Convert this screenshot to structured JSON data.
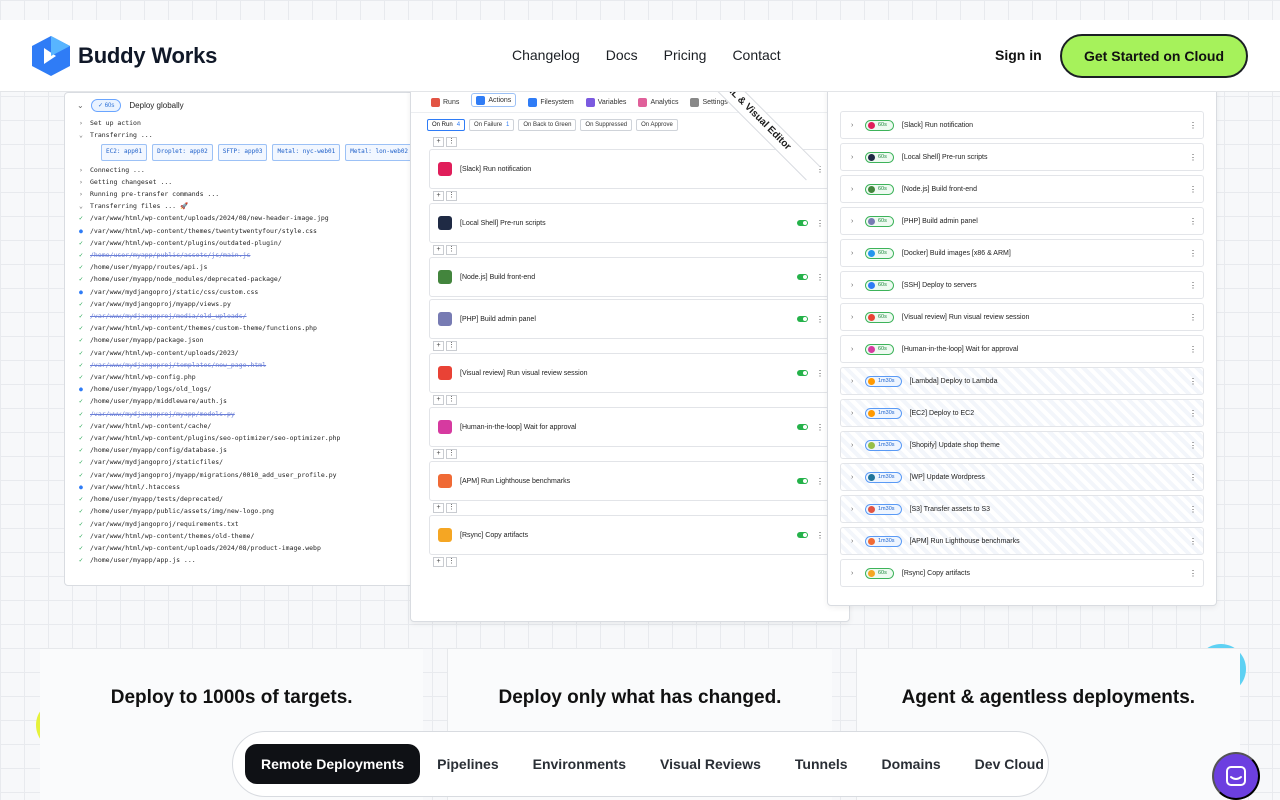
{
  "header": {
    "logo_text": "Buddy Works",
    "nav": [
      "Changelog",
      "Docs",
      "Pricing",
      "Contact"
    ],
    "sign_in": "Sign in",
    "cta": "Get Started on Cloud"
  },
  "log_panel": {
    "status": "60s",
    "title": "Deploy globally",
    "setup": "Set up action",
    "transferring": "Transferring ...",
    "targets": [
      "EC2: app01",
      "Droplet: app02",
      "SFTP: app03",
      "Metal: nyc-web01",
      "Metal: lon-web02",
      "Metal: sfo"
    ],
    "steps": [
      {
        "mark": "chev",
        "text": "Connecting ..."
      },
      {
        "mark": "chev",
        "text": "Getting changeset ..."
      },
      {
        "mark": "chev",
        "text": "Running pre-transfer commands ..."
      },
      {
        "mark": "open",
        "text": "Transferring files ... 🚀"
      }
    ],
    "files": [
      {
        "mark": "ok",
        "path": "/var/www/html/wp-content/uploads/2024/08/new-header-image.jpg"
      },
      {
        "mark": "dot",
        "path": "/var/www/html/wp-content/themes/twentytwentyfour/style.css"
      },
      {
        "mark": "ok",
        "path": "/var/www/html/wp-content/plugins/outdated-plugin/"
      },
      {
        "mark": "ok",
        "path": "/home/user/myapp/public/assets/js/main.js",
        "deleted": true
      },
      {
        "mark": "ok",
        "path": "/home/user/myapp/routes/api.js"
      },
      {
        "mark": "ok",
        "path": "/home/user/myapp/node_modules/deprecated-package/"
      },
      {
        "mark": "dot",
        "path": "/var/www/mydjangoproj/static/css/custom.css"
      },
      {
        "mark": "ok",
        "path": "/var/www/mydjangoproj/myapp/views.py"
      },
      {
        "mark": "ok",
        "path": "/var/www/mydjangoproj/media/old_uploads/",
        "deleted": true
      },
      {
        "mark": "ok",
        "path": "/var/www/html/wp-content/themes/custom-theme/functions.php"
      },
      {
        "mark": "ok",
        "path": "/home/user/myapp/package.json"
      },
      {
        "mark": "ok",
        "path": "/var/www/html/wp-content/uploads/2023/"
      },
      {
        "mark": "ok",
        "path": "/var/www/mydjangoproj/templates/new_page.html",
        "deleted": true
      },
      {
        "mark": "ok",
        "path": "/var/www/html/wp-config.php"
      },
      {
        "mark": "dot",
        "path": "/home/user/myapp/logs/old_logs/"
      },
      {
        "mark": "ok",
        "path": "/home/user/myapp/middleware/auth.js"
      },
      {
        "mark": "ok",
        "path": "/var/www/mydjangoproj/myapp/models.py",
        "deleted": true
      },
      {
        "mark": "ok",
        "path": "/var/www/html/wp-content/cache/"
      },
      {
        "mark": "ok",
        "path": "/var/www/html/wp-content/plugins/seo-optimizer/seo-optimizer.php"
      },
      {
        "mark": "ok",
        "path": "/home/user/myapp/config/database.js"
      },
      {
        "mark": "ok",
        "path": "/var/www/mydjangoproj/staticfiles/"
      },
      {
        "mark": "ok",
        "path": "/var/www/mydjangoproj/myapp/migrations/0010_add_user_profile.py"
      },
      {
        "mark": "dot",
        "path": "/var/www/html/.htaccess"
      },
      {
        "mark": "ok",
        "path": "/home/user/myapp/tests/deprecated/"
      },
      {
        "mark": "ok",
        "path": "/home/user/myapp/public/assets/img/new-logo.png"
      },
      {
        "mark": "ok",
        "path": "/var/www/mydjangoproj/requirements.txt"
      },
      {
        "mark": "ok",
        "path": "/var/www/html/wp-content/themes/old-theme/"
      },
      {
        "mark": "ok",
        "path": "/var/www/html/wp-content/uploads/2024/08/product-image.webp"
      },
      {
        "mark": "ok",
        "path": "/home/user/myapp/app.js ..."
      }
    ]
  },
  "editor_panel": {
    "tabs": [
      "Runs",
      "Actions",
      "Filesystem",
      "Variables",
      "Analytics",
      "Settings"
    ],
    "active_tab": "Actions",
    "filters": [
      {
        "label": "On Run",
        "count": "4"
      },
      {
        "label": "On Failure",
        "count": "1"
      },
      {
        "label": "On Back to Green",
        "count": ""
      },
      {
        "label": "On Suppressed",
        "count": ""
      },
      {
        "label": "On Approve",
        "count": ""
      }
    ],
    "actions": [
      {
        "name": "[Slack] Run notification",
        "icon": "slack-icon",
        "color": "#e01e5a"
      },
      {
        "name": "[Local Shell] Pre-run scripts",
        "icon": "shell-icon",
        "color": "#1f2a44"
      },
      {
        "name": "[Node.js] Build front-end",
        "icon": "nodejs-icon",
        "color": "#43853d"
      },
      {
        "name": "[PHP] Build admin panel",
        "icon": "php-icon",
        "color": "#777bb3"
      },
      {
        "name": "[Visual review] Run visual review session",
        "icon": "chrome-icon",
        "color": "#e94235"
      },
      {
        "name": "[Human-in-the-loop] Wait for approval",
        "icon": "approval-icon",
        "color": "#d63aa0"
      },
      {
        "name": "[APM] Run Lighthouse benchmarks",
        "icon": "lighthouse-icon",
        "color": "#f06a35"
      },
      {
        "name": "[Rsync] Copy artifacts",
        "icon": "rsync-icon",
        "color": "#f5a623"
      }
    ],
    "ribbon": "YAML & Visual Editor"
  },
  "stack_panel": {
    "rows": [
      {
        "time": "60s",
        "name": "[Slack] Run notification",
        "color": "#e01e5a"
      },
      {
        "time": "60s",
        "name": "[Local Shell] Pre-run scripts",
        "color": "#1f2a44"
      },
      {
        "time": "60s",
        "name": "[Node.js] Build front-end",
        "color": "#43853d"
      },
      {
        "time": "60s",
        "name": "[PHP] Build admin panel",
        "color": "#777bb3"
      },
      {
        "time": "60s",
        "name": "[Docker] Build images [x86 & ARM]",
        "color": "#2496ed"
      },
      {
        "time": "60s",
        "name": "[SSH] Deploy to servers",
        "color": "#2f7cf6"
      },
      {
        "time": "60s",
        "name": "[Visual review] Run visual review session",
        "color": "#e94235"
      },
      {
        "time": "60s",
        "name": "[Human-in-the-loop] Wait for approval",
        "color": "#d63aa0"
      },
      {
        "time": "1m30s",
        "name": "[Lambda] Deploy to Lambda",
        "color": "#f90",
        "blue": true
      },
      {
        "time": "1m30s",
        "name": "[EC2] Deploy to EC2",
        "color": "#f90",
        "blue": true
      },
      {
        "time": "1m30s",
        "name": "[Shopify] Update shop theme",
        "color": "#96bf48",
        "blue": true
      },
      {
        "time": "1m30s",
        "name": "[WP] Update Wordpress",
        "color": "#21759b",
        "blue": true
      },
      {
        "time": "1m30s",
        "name": "[S3] Transfer assets to S3",
        "color": "#e25444",
        "blue": true
      },
      {
        "time": "1m30s",
        "name": "[APM] Run Lighthouse benchmarks",
        "color": "#f06a35",
        "blue": true
      },
      {
        "time": "60s",
        "name": "[Rsync] Copy artifacts",
        "color": "#f5a623"
      }
    ]
  },
  "features": [
    "Deploy to 1000s of targets.",
    "Deploy only what has changed.",
    "Agent & agentless deployments."
  ],
  "tabs": [
    "Remote Deployments",
    "Pipelines",
    "Environments",
    "Visual Reviews",
    "Tunnels",
    "Domains",
    "Dev Cloud"
  ],
  "active_tab": "Remote Deployments",
  "colors": {
    "cta": "#a6f25b",
    "brand_blue": "#2f7cf6",
    "chat": "#6c3fe0",
    "ok": "#1aa34a"
  }
}
